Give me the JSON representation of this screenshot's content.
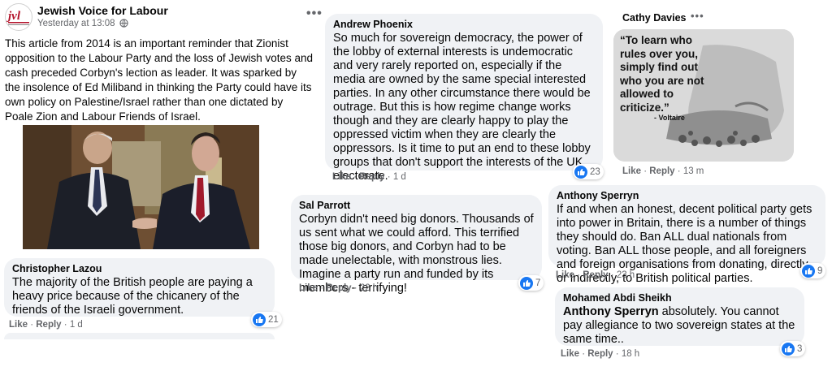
{
  "post": {
    "page_name": "Jewish Voice for Labour",
    "timestamp": "Yesterday at 13:08",
    "logo_text": "jvl",
    "body": "This article from 2014 is an important reminder that Zionist opposition to the Labour Party and the loss of Jewish votes and cash preceded Corbyn's lection as leader. It was sparked by the insolence of Ed Miliband in thinking the Party could have its own policy on Palestine/Israel rather than one dictated by Poale Zion and Labour Friends of Israel."
  },
  "comments": {
    "christopher": {
      "author": "Christopher Lazou",
      "text": "The majority of the British people are paying a heavy price because of the chicanery of the friends of the Israeli government.",
      "like": "Like",
      "reply": "Reply",
      "time": "1 d",
      "reactions": "21"
    },
    "andrew": {
      "author": "Andrew Phoenix",
      "text": "So much for sovereign democracy, the power of the lobby of external interests is undemocratic and very rarely reported on, especially if the media are owned by the same special interested parties. In any other circumstance there would be outrage. But this is how regime change works though and they are clearly happy to play the oppressed victim when they are clearly the oppressors. Is it time to put an end to these lobby groups that don't support the interests of the UK electorate.",
      "like": "Like",
      "reply": "Reply",
      "time": "1 d",
      "reactions": "23"
    },
    "sal": {
      "author": "Sal Parrott",
      "text": "Corbyn didn't need big donors. Thousands of us sent what we could afford. This terrified those big donors, and Corbyn had to be made unelectable, with monstrous lies. Imagine a party run and funded by its members - terrifying!",
      "like": "Like",
      "reply": "Reply",
      "time": "22 h",
      "reactions": "7"
    },
    "cathy": {
      "author": "Cathy Davies",
      "image_quote": "“To learn who rules over you, simply find out who you are not allowed to criticize.”",
      "image_attribution": "- Voltaire",
      "like": "Like",
      "reply": "Reply",
      "time": "13 m"
    },
    "anthony": {
      "author": "Anthony Sperryn",
      "text": "If and when an honest, decent political party gets into power in Britain, there is a number of things they should do. Ban ALL dual nationals from voting. Ban ALL those people, and all foreigners and foreign organisations from donating, directly, or indirectly, to British political parties.",
      "like": "Like",
      "reply": "Reply",
      "time": "23 h",
      "reactions": "9"
    },
    "mohamed": {
      "author": "Mohamed Abdi Sheikh",
      "mention": "Anthony Sperryn",
      "text": " absolutely. You cannot pay allegiance to two sovereign states at the same time..",
      "like": "Like",
      "reply": "Reply",
      "time": "18 h",
      "reactions": "3"
    }
  },
  "colors": {
    "like_blue": "#1877f2",
    "bubble": "#f0f2f5",
    "meta": "#65676b"
  },
  "icons": [
    "more-options-icon",
    "like-reaction-icon"
  ]
}
